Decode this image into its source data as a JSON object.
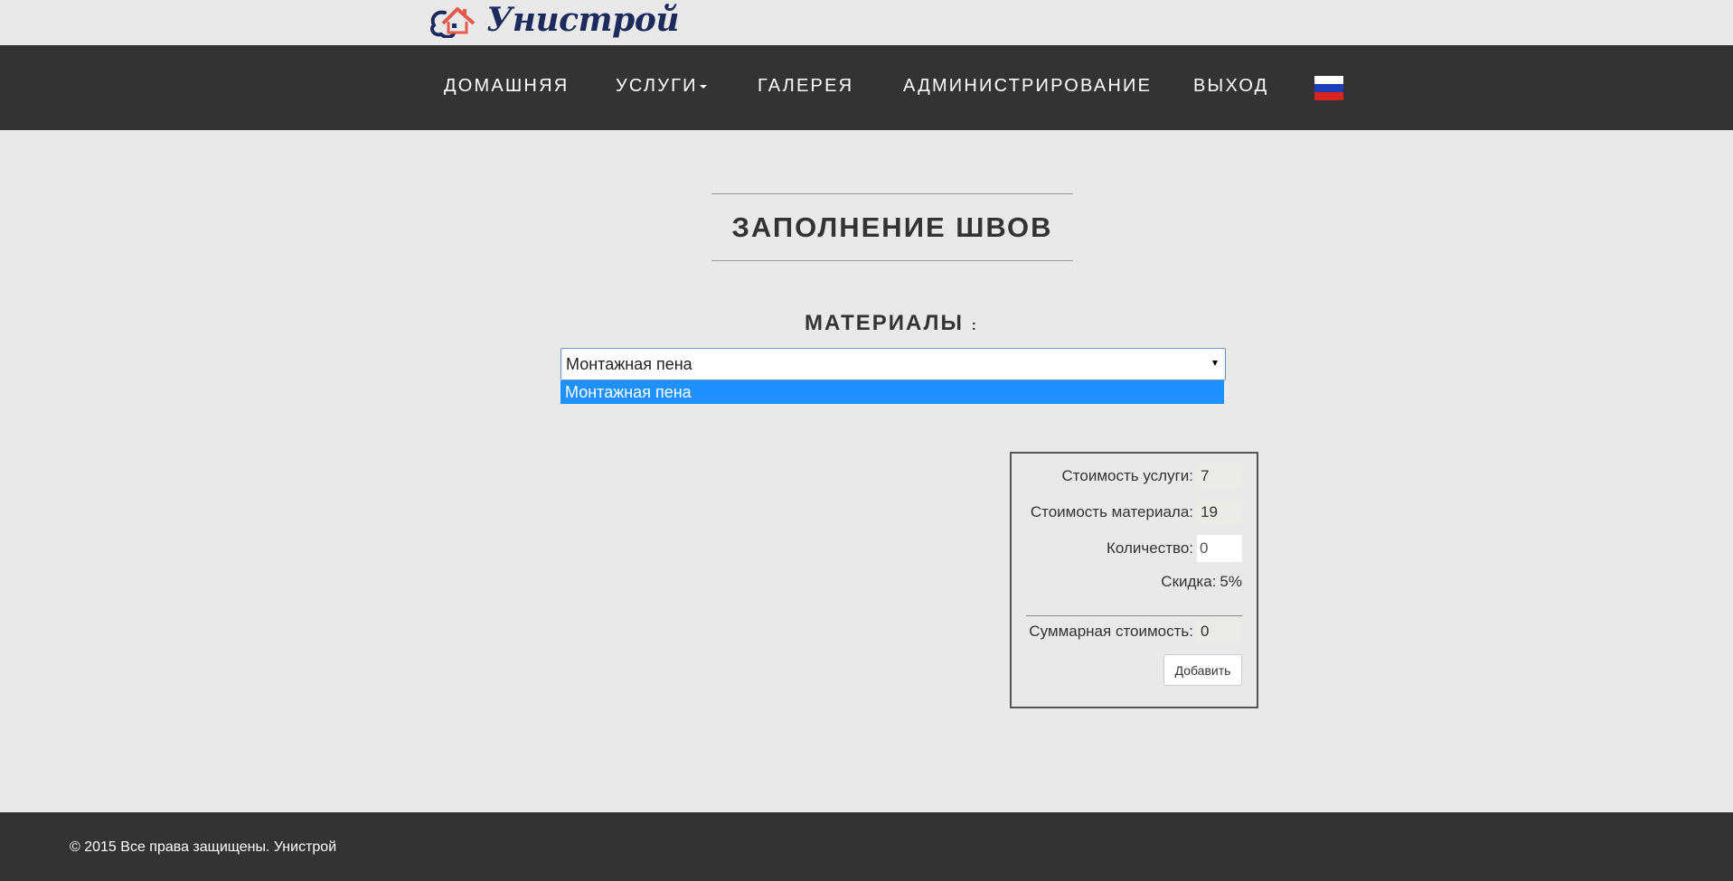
{
  "brand": {
    "name": "Унистрой",
    "accent": "#e65a4b",
    "primary": "#1d2b5c"
  },
  "nav": {
    "items": [
      {
        "label": "ДОМАШНЯЯ"
      },
      {
        "label": "УСЛУГИ"
      },
      {
        "label": "ГАЛЕРЕЯ"
      },
      {
        "label": "АДМИНИСТРИРОВАНИЕ"
      },
      {
        "label": "ВЫХОД"
      }
    ],
    "language_icon": "russia-flag-icon"
  },
  "page": {
    "title": "ЗАПОЛНЕНИЕ ШВОВ",
    "materials_label": "МАТЕРИАЛЫ",
    "materials_colon": ":"
  },
  "materials_select": {
    "selected": "Монтажная пена",
    "options": [
      "Монтажная пена"
    ]
  },
  "calculator": {
    "service_cost_label": "Стоимость услуги:",
    "service_cost_value": "7",
    "material_cost_label": "Стоимость материала:",
    "material_cost_value": "19",
    "quantity_label": "Количество:",
    "quantity_value": "0",
    "discount_label": "Скидка:",
    "discount_value": "5%",
    "total_label": "Суммарная стоимость:",
    "total_value": "0",
    "add_button": "Добавить"
  },
  "footer": {
    "copyright": "© 2015 Все права защищены. Унистрой"
  }
}
